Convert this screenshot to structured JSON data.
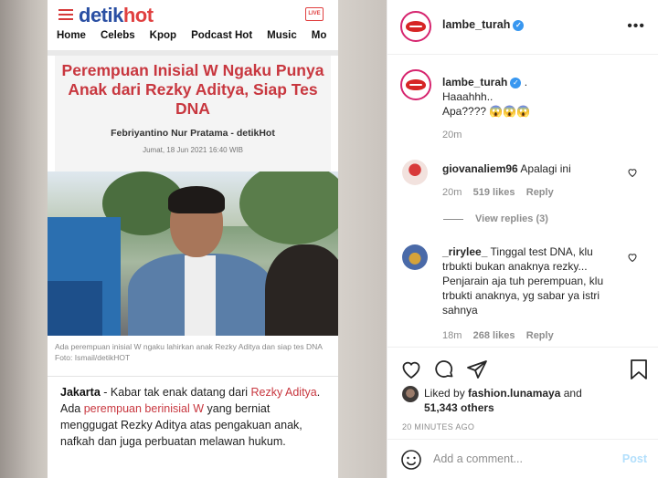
{
  "article": {
    "logo_a": "detik",
    "logo_b": "hot",
    "live_badge": "LIVE",
    "nav": [
      "Home",
      "Celebs",
      "Kpop",
      "Podcast Hot",
      "Music",
      "Mo"
    ],
    "headline": "Perempuan Inisial W Ngaku Punya Anak dari Rezky Aditya, Siap Tes DNA",
    "byline": "Febriyantino Nur Pratama - detikHot",
    "date": "Jumat, 18 Jun 2021 16:40 WIB",
    "caption": "Ada perempuan inisial W ngaku lahirkan anak Rezky Aditya dan siap tes DNA Foto: Ismail/detikHOT",
    "body_city": "Jakarta",
    "body_1": " - Kabar tak enak datang dari ",
    "body_link1": "Rezky Aditya",
    "body_2": ". Ada ",
    "body_link2": "perempuan berinisial W",
    "body_3": " yang berniat menggugat Rezky Aditya atas pengakuan anak, nafkah dan juga perbuatan melawan hukum."
  },
  "post": {
    "username": "lambe_turah",
    "more_icon": "more-horizontal-icon",
    "caption_user": "lambe_turah",
    "caption_suffix": " .",
    "caption_line1": "Haaahhh..",
    "caption_line2": "Apa???? 😱😱😱",
    "caption_time": "20m"
  },
  "comments": [
    {
      "user": "giovanaliem96",
      "text": "Apalagi ini",
      "time": "20m",
      "likes": "519 likes",
      "reply": "Reply",
      "view_replies": "View replies (3)"
    },
    {
      "user": "_rirylee_",
      "text": "Tinggal test DNA, klu trbukti bukan anaknya rezky...",
      "text2": "Penjarain aja tuh perempuan, klu trbukti anaknya, yg sabar ya istri sahnya",
      "time": "18m",
      "likes": "268 likes",
      "reply": "Reply"
    }
  ],
  "likes": {
    "prefix": "Liked by ",
    "liker": "fashion.lunamaya",
    "mid": " and",
    "count": "51,343 others"
  },
  "timestamp": "20 MINUTES AGO",
  "add_comment": {
    "placeholder": "Add a comment...",
    "post_label": "Post"
  },
  "colors": {
    "accent_red": "#c8373f",
    "verified_blue": "#3897f0",
    "post_disabled": "#b2dffc"
  }
}
